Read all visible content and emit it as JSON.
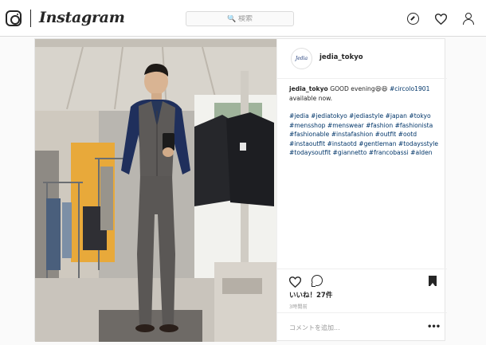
{
  "nav": {
    "wordmark": "Instagram",
    "search_placeholder": "🔍 検索",
    "icons": [
      "instagram-glyph-icon",
      "compass-icon",
      "heart-icon",
      "user-icon"
    ]
  },
  "post": {
    "username": "jedia_tokyo",
    "avatar_text": "Jedia",
    "caption_user": "jedia_tokyo",
    "caption_text": " GOOD evening😆😆 ",
    "caption_tag": "#circolo1901",
    "caption_tail": " available now.",
    "hashtags": "#jedia #jediatokyo #jediastyle #japan #tokyo #mensshop #menswear #fashion #fashionista #fashionable #instafashion #outfit #ootd #instaoutfit #instaotd #gentleman #todaysstyle #todaysoutfit #giannetto #francobassi #alden",
    "likes": "いいね！27件",
    "time": "3時間前",
    "comment_placeholder": "コメントを追加...",
    "more": "•••"
  },
  "colors": {
    "accent_link": "#003569",
    "border": "#dbdbdb",
    "background": "#fafafa"
  }
}
